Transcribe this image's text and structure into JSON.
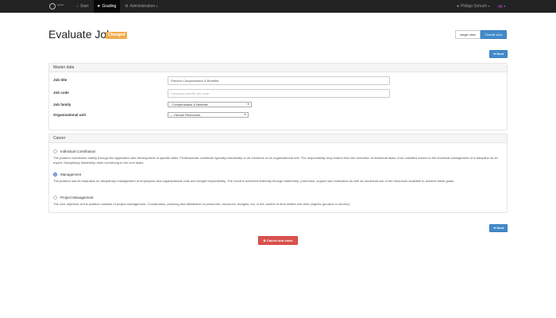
{
  "navbar": {
    "logo_text": "grader",
    "items": [
      {
        "label": "Start",
        "icon": "home-icon"
      },
      {
        "label": "Grading",
        "icon": "star-icon"
      },
      {
        "label": "Administration",
        "icon": "gear-icon"
      }
    ],
    "user": "Philipp Schuch",
    "language": "en-flag-icon"
  },
  "header": {
    "title": "Evaluate Job",
    "status": "Changed",
    "view_single": "single view",
    "view_overall": "Overall view"
  },
  "actions": {
    "next": "Next",
    "cancel": "Cancel and close"
  },
  "master_data": {
    "heading": "Master data",
    "job_title_label": "Job title",
    "job_title_value": "Director Compensation & Benefits",
    "job_code_label": "Job code",
    "job_code_placeholder": "Company-specific job code",
    "job_family_label": "Job family",
    "job_family_value": "- Compensation & Benefits",
    "org_unit_label": "Organisational unit",
    "org_unit_value": "— Human Resources"
  },
  "career": {
    "heading": "Career",
    "options": [
      {
        "label": "Individual Contribution",
        "checked": false,
        "description": "The position contributes mainly through the application and development of specific skills. Professionals contribute typically individually or as members of an organizational unit. The responsibility may extend from the execution of individual tasks of an unskilled worker to the technical management of a discipline as an expert. Disciplinary leadership does not belong to the core tasks."
      },
      {
        "label": "Management",
        "checked": true,
        "description": "The position has its emphasis on disciplinary management of employees and organizational units and budget responsibility. The result is achieved indirectly through leadership, promotion, support and motivation as well as functional use of the resources available to achieve these goals."
      },
      {
        "label": "Project Management",
        "checked": false,
        "description": "The core objective of the position consists of project management. Coordination, planning and distribution of personnel, resources, budgets, etc. in the context of time-limited one-time projects (product or service)."
      }
    ]
  },
  "colors": {
    "primary": "#428bca",
    "warning": "#f0ad4e",
    "danger": "#d9534f",
    "navbar": "#222222"
  }
}
